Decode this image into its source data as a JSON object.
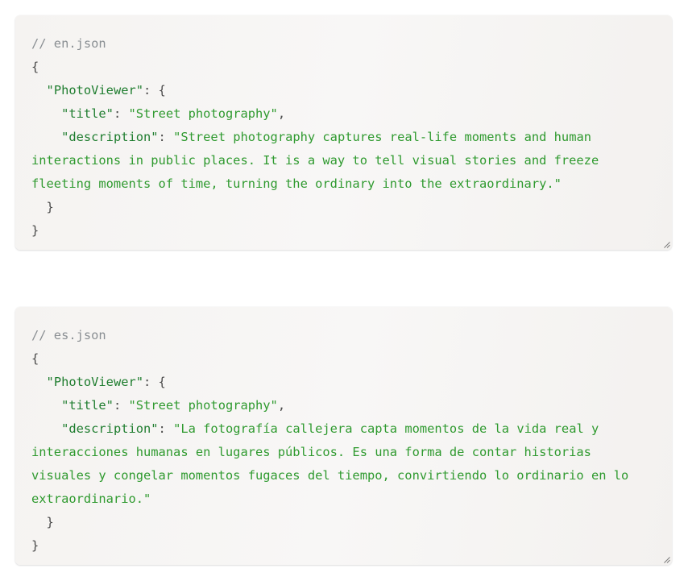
{
  "blocks": [
    {
      "comment": "// en.json",
      "open_brace": "{",
      "object_key": "\"PhotoViewer\"",
      "object_open": ": {",
      "title_key": "\"title\"",
      "title_sep": ": ",
      "title_value": "\"Street photography\"",
      "title_comma": ",",
      "desc_key": "\"description\"",
      "desc_sep": ": ",
      "desc_value": "\"Street photography captures real-life moments and human interactions in public places. It is a way to tell visual stories and freeze fleeting moments of time, turning the ordinary into the extraordinary.\"",
      "inner_close": "}",
      "outer_close": "}"
    },
    {
      "comment": "// es.json",
      "open_brace": "{",
      "object_key": "\"PhotoViewer\"",
      "object_open": ": {",
      "title_key": "\"title\"",
      "title_sep": ": ",
      "title_value": "\"Street photography\"",
      "title_comma": ",",
      "desc_key": "\"description\"",
      "desc_sep": ": ",
      "desc_value": "\"La fotografía callejera capta momentos de la vida real y interacciones humanas en lugares públicos. Es una forma de contar historias visuales y congelar momentos fugaces del tiempo, convirtiendo lo ordinario en lo extraordinario.\"",
      "inner_close": "}",
      "outer_close": "}"
    }
  ]
}
